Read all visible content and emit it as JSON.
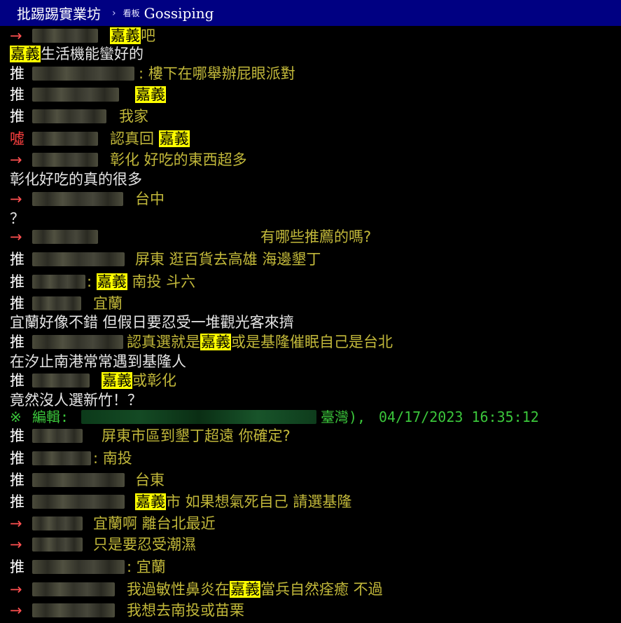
{
  "header": {
    "site": "批踢踢實業坊",
    "chevron": "›",
    "board_label": "看板",
    "board": "Gossiping"
  },
  "tags": {
    "push": "推",
    "arrow": "→",
    "boo": "噓"
  },
  "highlight_word": "嘉義",
  "edit": {
    "mark": "※",
    "label": "編輯:",
    "location": "臺灣),",
    "datetime": "04/17/2023 16:35:12"
  },
  "lines": [
    {
      "pre": "",
      "hl": "嘉義",
      "post": "吧"
    },
    {
      "pre": "",
      "hl": "嘉義",
      "post": "生活機能蠻好的"
    },
    {
      "pre": ":  樓下在哪舉辦屁眼派對",
      "hl": "",
      "post": ""
    },
    {
      "pre": "",
      "hl": "嘉義",
      "post": ""
    },
    {
      "pre": "我家",
      "hl": "",
      "post": ""
    },
    {
      "pre": "認真回   ",
      "hl": "嘉義",
      "post": ""
    },
    {
      "pre": "彰化  好吃的東西超多",
      "hl": "",
      "post": ""
    },
    {
      "pre": "彰化好吃的真的很多",
      "hl": "",
      "post": ""
    },
    {
      "pre": "台中",
      "hl": "",
      "post": ""
    },
    {
      "pre": "？",
      "hl": "",
      "post": ""
    },
    {
      "pre": "有哪些推薦的嗎?",
      "hl": "",
      "post": ""
    },
    {
      "pre": "屏東  逛百貨去高雄  海邊墾丁",
      "hl": "",
      "post": ""
    },
    {
      "pre": ": ",
      "hl": "嘉義",
      "post": "  南投  斗六"
    },
    {
      "pre": "宜蘭",
      "hl": "",
      "post": ""
    },
    {
      "pre": "宜蘭好像不錯  但假日要忍受一堆觀光客來擠",
      "hl": "",
      "post": ""
    },
    {
      "pre": "認真選就是",
      "hl": "嘉義",
      "post": "或是基隆催眠自己是台北"
    },
    {
      "pre": "在汐止南港常常遇到基隆人",
      "hl": "",
      "post": ""
    },
    {
      "pre": "",
      "hl": "嘉義",
      "post": "或彰化"
    },
    {
      "pre": "竟然沒人選新竹！？",
      "hl": "",
      "post": ""
    },
    {
      "pre": "屏東市區到墾丁超遠  你確定?",
      "hl": "",
      "post": ""
    },
    {
      "pre": ":  南投",
      "hl": "",
      "post": ""
    },
    {
      "pre": "台東",
      "hl": "",
      "post": ""
    },
    {
      "pre": "",
      "hl": "嘉義",
      "post": "市  如果想氣死自己  請選基隆"
    },
    {
      "pre": "宜蘭啊  離台北最近",
      "hl": "",
      "post": ""
    },
    {
      "pre": "只是要忍受潮濕",
      "hl": "",
      "post": ""
    },
    {
      "pre": ":  宜蘭",
      "hl": "",
      "post": ""
    },
    {
      "pre": "我過敏性鼻炎在",
      "hl": "嘉義",
      "post": "當兵自然痊癒  不過"
    },
    {
      "pre": "我想去南投或苗栗",
      "hl": "",
      "post": ""
    }
  ]
}
